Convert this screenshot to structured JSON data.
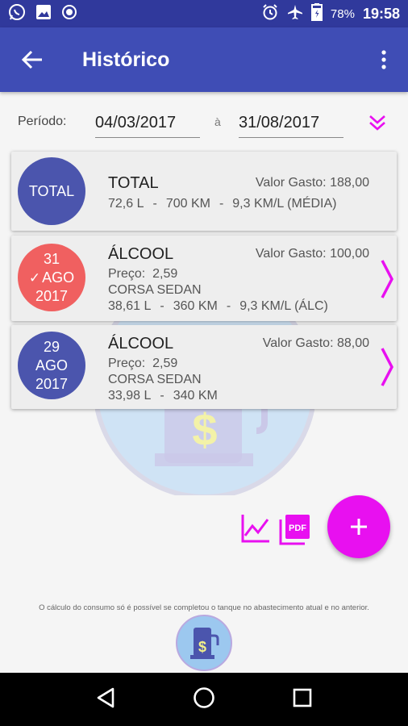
{
  "status_bar": {
    "battery": "78%",
    "time": "19:58"
  },
  "app_bar": {
    "title": "Histórico"
  },
  "period": {
    "label": "Período:",
    "start": "04/03/2017",
    "separator": "à",
    "end": "31/08/2017"
  },
  "total_card": {
    "circle_label": "TOTAL",
    "title": "TOTAL",
    "value": "Valor Gasto: 188,00",
    "liters": "72,6 L",
    "km": "700 KM",
    "consumption": "9,3 KM/L (MÉDIA)"
  },
  "records": [
    {
      "day": "31",
      "month": "AGO",
      "year": "2017",
      "completed": true,
      "fuel": "ÁLCOOL",
      "value": "Valor Gasto: 100,00",
      "price": "Preço:  2,59",
      "vehicle": "CORSA SEDAN",
      "liters": "38,61 L",
      "km": "360 KM",
      "consumption": "9,3 KM/L (ÁLC)"
    },
    {
      "day": "29",
      "month": "AGO",
      "year": "2017",
      "completed": false,
      "fuel": "ÁLCOOL",
      "value": "Valor Gasto: 88,00",
      "price": "Preço:  2,59",
      "vehicle": "CORSA SEDAN",
      "liters": "33,98 L",
      "km": "340 KM",
      "consumption": ""
    }
  ],
  "sep": "-",
  "footer": {
    "note": "O cálculo do consumo só é possível se completou o tanque no abastecimento atual e no anterior."
  },
  "icons": {
    "pdf": "PDF"
  },
  "colors": {
    "primary": "#3f4db5",
    "primary_dark": "#30399c",
    "accent": "#e810f0",
    "circle_blue": "#4b55ad",
    "circle_red": "#f06060"
  }
}
